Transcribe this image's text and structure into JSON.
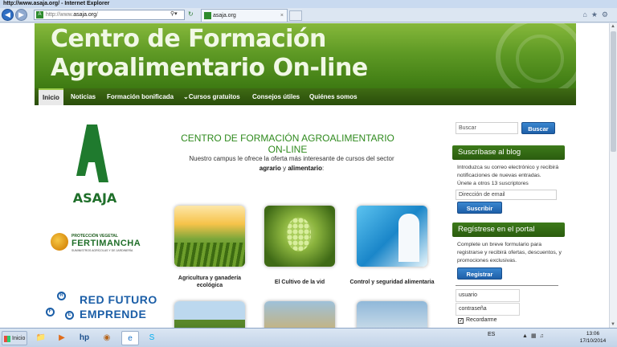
{
  "window": {
    "title": "http://www.asaja.org/ - Internet Explorer",
    "address_prefix": "http://www.",
    "address_domain": "asaja.org",
    "address_suffix": "/",
    "tab_label": "asaja.org"
  },
  "header": {
    "title_line1": "Centro de Formación",
    "title_line2": "Agroalimentario On-line"
  },
  "menu": {
    "items": [
      "Inicio",
      "Noticias",
      "Formación bonificada",
      "Cursos gratuitos",
      "Consejos útiles",
      "Quiénes somos"
    ],
    "active": "Inicio"
  },
  "logos": {
    "asaja": "ASAJA",
    "fertimancha_top": "PROTECCIÓN VEGETAL",
    "fertimancha_name": "FERTIMANCHA",
    "fertimancha_sub": "SUMINISTROS AGRÍCOLAS Y DE JARDINERÍA",
    "red_line1": "RED FUTURO",
    "red_line2": "EMPRENDE",
    "red_letters": [
      "R",
      "E",
      "F"
    ]
  },
  "main": {
    "title": "CENTRO DE FORMACIÓN AGROALIMENTARIO ON-LINE",
    "intro_part1": "Nuestro campus le ofrece la oferta más interesante de cursos del sector ",
    "intro_bold1": "agrario",
    "intro_part2": " y ",
    "intro_bold2": "alimentario",
    "intro_part3": ":",
    "courses": [
      {
        "label": "Agricultura y ganadería ecológica"
      },
      {
        "label": "El Cultivo de la vid"
      },
      {
        "label": "Control y seguridad alimentaria"
      }
    ]
  },
  "sidebar": {
    "search_placeholder": "Buscar",
    "search_button": "Buscar",
    "subscribe_title": "Suscríbase al blog",
    "subscribe_text": "Introduzca su correo electrónico y recibirá notificaciones de nuevas entradas.",
    "subscribe_count": "Únete a otros 13 suscriptores",
    "email_placeholder": "Dirección de email",
    "subscribe_button": "Suscribir",
    "register_title": "Regístrese en el portal",
    "register_text": "Complete un breve formulario para registrarse y recibirá ofertas, descuentos, y promociones exclusivas.",
    "register_button": "Registrar",
    "username_label": "usuario",
    "password_label": "contraseña",
    "remember_label": "Recordarme"
  },
  "taskbar": {
    "start_label": "Inicio",
    "language": "ES",
    "time": "13:06",
    "date": "17/10/2014"
  }
}
